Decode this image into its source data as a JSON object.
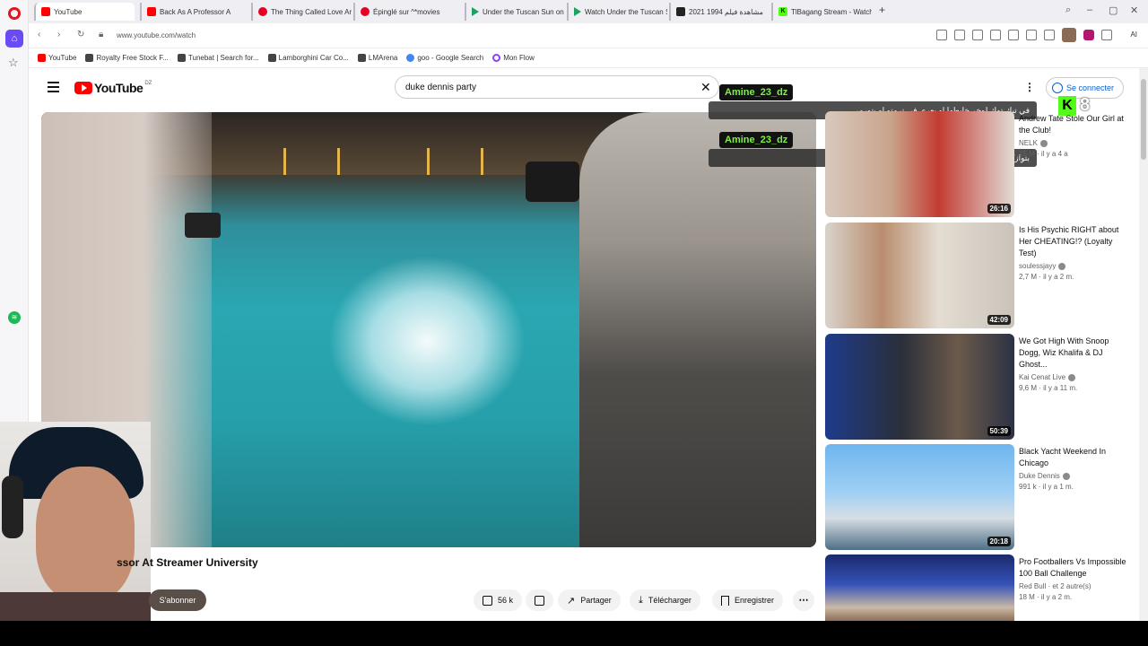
{
  "browser": {
    "tabs": [
      {
        "label": "YouTube",
        "icon": "youtube-icon"
      },
      {
        "label": "Back As A Professor A",
        "icon": "youtube-icon"
      },
      {
        "label": "The Thing Called Love Ar",
        "icon": "pinterest-icon"
      },
      {
        "label": "Épinglé sur ^*movies",
        "icon": "pinterest-icon"
      },
      {
        "label": "Under the Tuscan Sun on",
        "icon": "play-icon"
      },
      {
        "label": "Watch Under the Tuscan S",
        "icon": "play-icon"
      },
      {
        "label": "مشاهدة فيلم 1994 2021",
        "icon": "site-icon"
      },
      {
        "label": "TlBagang Stream - Watch",
        "icon": "kick-icon"
      }
    ],
    "url": "www.youtube.com/watch",
    "ai_label": "AI",
    "bookmarks": [
      {
        "label": "YouTube"
      },
      {
        "label": "Royalty Free Stock F..."
      },
      {
        "label": "Tunebat | Search for..."
      },
      {
        "label": "Lamborghini Car Co..."
      },
      {
        "label": "LMArena"
      },
      {
        "label": "goo - Google Search"
      },
      {
        "label": "Mon Flow"
      }
    ]
  },
  "youtube": {
    "logo_text": "YouTube",
    "country_code": "DZ",
    "search_value": "duke dennis party",
    "signin_label": "Se connecter",
    "video_title": "ssor At Streamer University",
    "subscribe_label": "S'abonner",
    "likes": "56 k",
    "share_label": "Partager",
    "download_label": "Télécharger",
    "save_label": "Enregistrer"
  },
  "chat": {
    "messages": [
      {
        "user": "Amine_23_dz",
        "text": "في تيك توك لوخر خابطها او يعري في ترمتو او بتورمي"
      },
      {
        "user": "Amine_23_dz",
        "text": "بتوازكي"
      }
    ],
    "badge_count": "8"
  },
  "recommendations": [
    {
      "title": "Andrew Tate Stole Our Girl at the Club!",
      "channel": "NELK",
      "meta": "15 M · il y a 4 a",
      "duration": "26:16"
    },
    {
      "title": "Is His Psychic RIGHT about Her CHEATING!? (Loyalty Test)",
      "channel": "soulessjayy",
      "meta": "2,7 M · il y a 2 m.",
      "duration": "42:09"
    },
    {
      "title": "We Got High With Snoop Dogg, Wiz Khalifa & DJ Ghost...",
      "channel": "Kai Cenat Live",
      "meta": "9,6 M · il y a 11 m.",
      "duration": "50:39"
    },
    {
      "title": "Black Yacht Weekend In Chicago",
      "channel": "Duke Dennis",
      "meta": "991 k · il y a 1 m.",
      "duration": "20:18"
    },
    {
      "title": "Pro Footballers Vs Impossible 100 Ball Challenge",
      "channel": "Red Bull · et 2 autre(s)",
      "meta": "18 M · il y a 2 m.",
      "duration": ""
    }
  ],
  "colors": {
    "youtube_red": "#ff0000",
    "link_blue": "#065fd4",
    "chat_name_green": "#7ff04a",
    "kick_green": "#53fc18",
    "opera_red": "#e3141d",
    "opera_accent": "#6b4bf5"
  }
}
